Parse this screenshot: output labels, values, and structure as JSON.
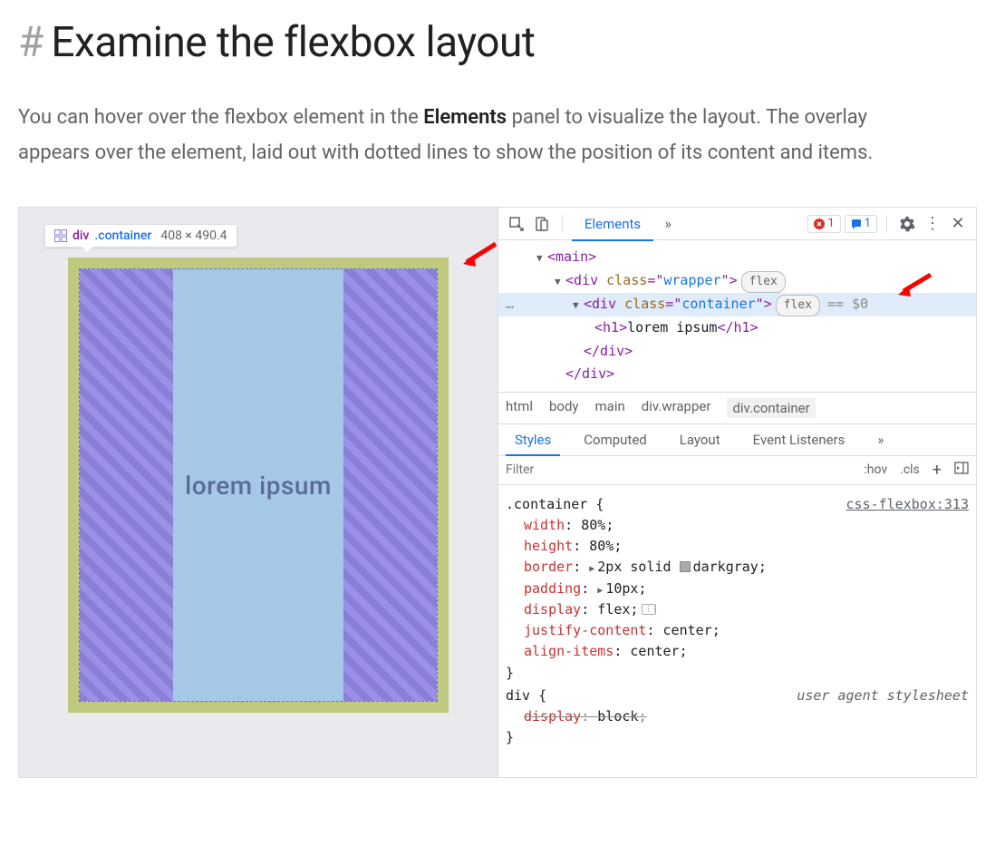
{
  "heading": {
    "hash": "#",
    "title": "Examine the flexbox layout"
  },
  "intro": {
    "pre": "You can hover over the flexbox element in the ",
    "bold": "Elements",
    "post": " panel to visualize the layout. The overlay appears over the element, laid out with dotted lines to show the position of its content and items."
  },
  "tooltip": {
    "tag": "div",
    "cls": ".container",
    "dims": "408 × 490.4"
  },
  "preview_text": "lorem ipsum",
  "toolbar": {
    "elements_tab": "Elements",
    "more": "»",
    "errors": "1",
    "issues": "1"
  },
  "dom": {
    "line0_open": "<",
    "line0_tag": "main",
    "line0_close": ">",
    "line1_open": "<",
    "line1_tag": "div",
    "line1_sp": " ",
    "line1_attr": "class",
    "line1_eq": "=\"",
    "line1_val": "wrapper",
    "line1_q": "\"",
    "line1_end": ">",
    "line1_pill": "flex",
    "line2_open": "<",
    "line2_tag": "div",
    "line2_sp": " ",
    "line2_attr": "class",
    "line2_eq": "=\"",
    "line2_val": "container",
    "line2_q": "\"",
    "line2_end": ">",
    "line2_pill": "flex",
    "line2_suffix": "== $0",
    "line3_open": "<",
    "line3_tag": "h1",
    "line3_mid": ">",
    "line3_text": "lorem ipsum",
    "line3_close": "</",
    "line3_tag2": "h1",
    "line3_end": ">",
    "line4": "</div>",
    "line5": "</div>",
    "ellipsis": "…"
  },
  "breadcrumb": {
    "b0": "html",
    "b1": "body",
    "b2": "main",
    "b3_pre": "div",
    "b3_cls": ".wrapper",
    "b4_pre": "div",
    "b4_cls": ".container"
  },
  "subtabs": {
    "styles": "Styles",
    "computed": "Computed",
    "layout": "Layout",
    "events": "Event Listeners",
    "more": "»"
  },
  "filter": {
    "placeholder": "Filter",
    "hov": ":hov",
    "cls": ".cls",
    "plus": "+"
  },
  "styles": {
    "rule1_sel": ".container",
    "rule1_brace": " {",
    "rule1_src": "css-flexbox:313",
    "p1": "width",
    "c": ": ",
    "v1": "80%",
    "sc": ";",
    "p2": "height",
    "v2": "80%",
    "p3": "border",
    "v3a": "2px",
    "v3b": "solid",
    "v3c": "darkgray",
    "p4": "padding",
    "v4": "10px",
    "p5": "display",
    "v5": "flex",
    "p6": "justify-content",
    "v6": "center",
    "p7": "align-items",
    "v7": "center",
    "close": "}",
    "rule2_sel": "div",
    "rule2_src": "user agent stylesheet",
    "p8": "display",
    "v8": "block"
  }
}
